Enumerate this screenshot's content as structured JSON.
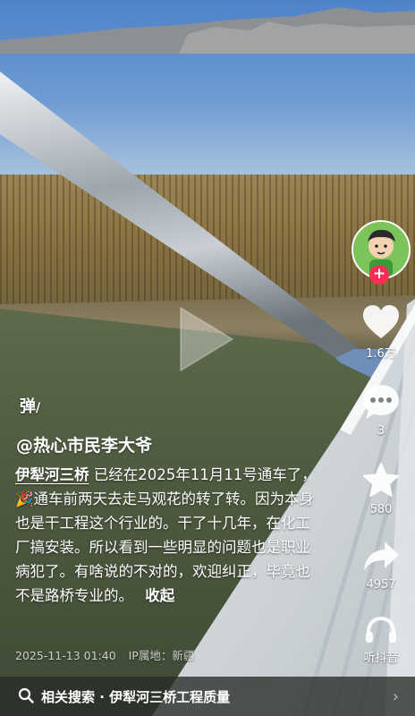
{
  "video": {
    "author": "@热心市民李大爷",
    "caption_hashtag": "伊犁河三桥",
    "caption_text": "已经在2025年11月11号通车了，🎉通车前两天去走马观花的转了转。因为本身也是干工程这个行业的。干了十几年，在化工厂搞安装。所以看到一些明显的问题也是职业病犯了。有啥说的不对的，欢迎纠正，毕竟也不是路桥专业的。",
    "collapse_label": "收起",
    "timestamp": "2025-11-13 01:40",
    "ip_location": "IP属地：新疆",
    "danmu_label": "弹"
  },
  "actions": {
    "like_count": "1.6万",
    "comment_count": "3",
    "favorite_count": "580",
    "share_count": "4957",
    "listen_label": "听抖音"
  },
  "search": {
    "label": "相关搜索 · 伊犁河三桥工程质量"
  },
  "colors": {
    "follow_red": "#fe2c55",
    "sky_blue": "#4e82c8",
    "rail_white": "#f2f4f5"
  }
}
